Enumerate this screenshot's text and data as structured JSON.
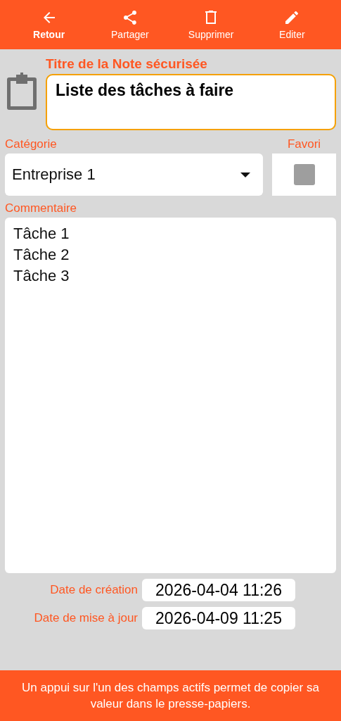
{
  "toolbar": [
    {
      "label": "Retour",
      "kind": "back",
      "selected": true
    },
    {
      "label": "Partager",
      "kind": "share",
      "selected": false
    },
    {
      "label": "Supprimer",
      "kind": "delete",
      "selected": false
    },
    {
      "label": "Editer",
      "kind": "edit",
      "selected": false
    }
  ],
  "title_field": {
    "label": "Titre de la Note sécurisée",
    "value": "Liste des tâches à faire"
  },
  "category": {
    "label": "Catégorie",
    "value": "Entreprise 1"
  },
  "favorite": {
    "label": "Favori",
    "checked": false
  },
  "comment": {
    "label": "Commentaire",
    "value": "Tâche 1\nTâche 2\nTâche 3"
  },
  "dates": [
    {
      "label": "Date de création",
      "value": "2026-04-04 11:26"
    },
    {
      "label": "Date de mise à jour",
      "value": "2026-04-09 11:25"
    }
  ],
  "footer": "Un appui sur l'un des champs actifs permet de copier sa valeur dans le presse-papiers."
}
